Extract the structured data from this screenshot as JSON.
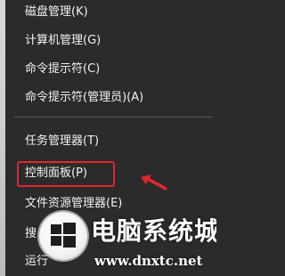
{
  "menu": {
    "items": [
      {
        "label": "磁盘管理(K)"
      },
      {
        "label": "计算机管理(G)"
      },
      {
        "label": "命令提示符(C)"
      },
      {
        "label": "命令提示符(管理员)(A)"
      },
      {
        "label": "任务管理器(T)"
      },
      {
        "label": "控制面板(P)"
      },
      {
        "label": "文件资源管理器(E)"
      },
      {
        "label": "搜"
      },
      {
        "label": "运行"
      }
    ]
  },
  "annotation": {
    "highlight_color": "#e0262c",
    "arrow_color": "#e0262c",
    "highlighted_item": "控制面板(P)"
  },
  "watermark": {
    "title": "电脑系统城",
    "url": "www.dnxtc.net",
    "logo": "windows-logo-icon"
  }
}
